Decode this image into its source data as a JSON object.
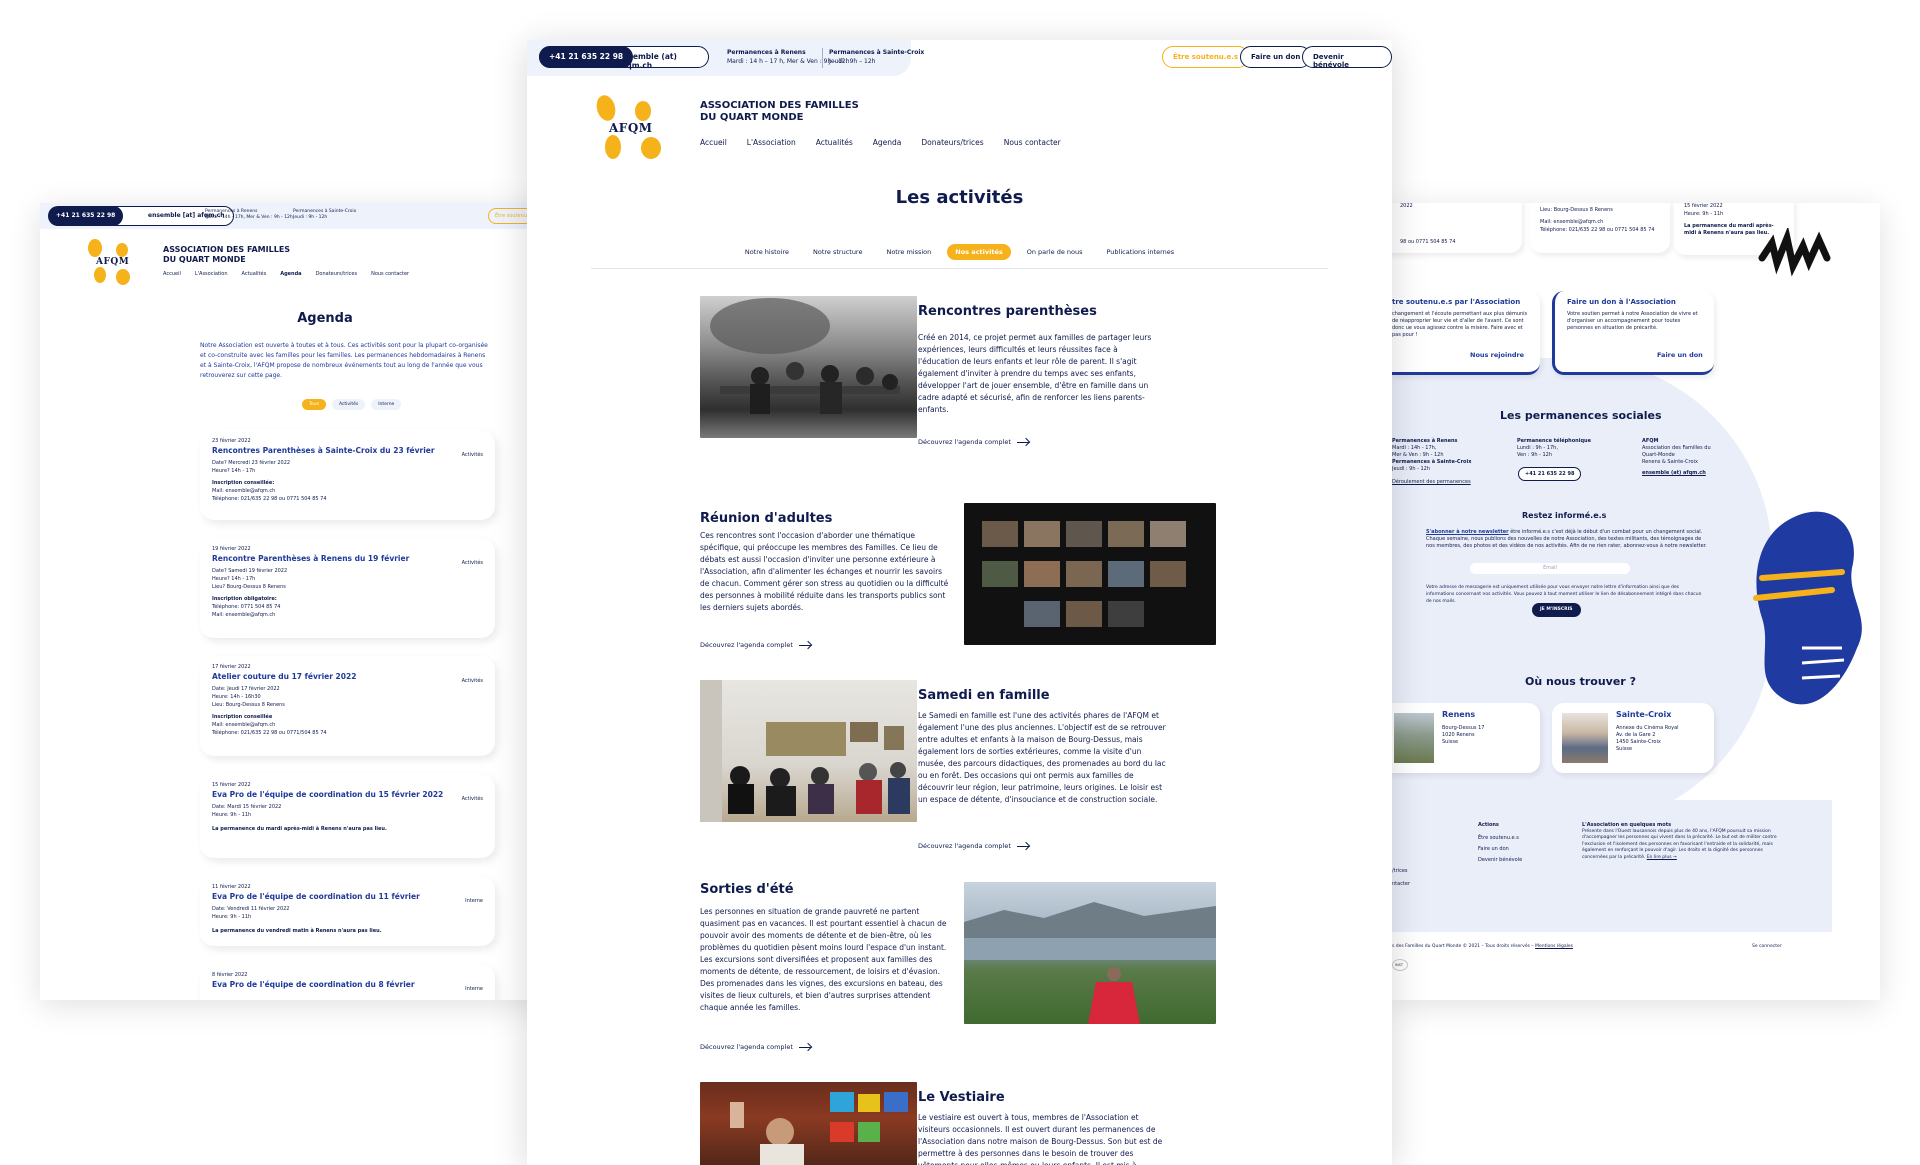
{
  "left": {
    "phone": "+41 21 635 22 98",
    "mail": "ensemble [at] afqm.ch",
    "perm_renens_title": "Permanences à Renens",
    "perm_renens_hours": "Mardi : 14h - 17h, Mer & Ven : 9h - 12h",
    "perm_sc_title": "Permanences à Sainte-Croix",
    "perm_sc_hours": "Jeudi : 9h - 12h",
    "soutenu_button": "Être soutenu.e.s",
    "logo_text": "AFQM",
    "assoc_line1": "ASSOCIATION DES FAMILLES",
    "assoc_line2": "DU QUART MONDE",
    "nav": [
      "Accueil",
      "L'Association",
      "Actualités",
      "Agenda",
      "Donateurs/trices",
      "Nous contacter"
    ],
    "title": "Agenda",
    "intro": "Notre Association est ouverte à toutes et à tous. Ces activités sont pour la plupart co-organisée et co-construite avec les familles pour les familles. Les permanences hebdomadaires à Renens et à Sainte-Croix, l'AFQM propose de nombreux événements tout au long de l'année que vous retrouverez sur cette page.",
    "filters": [
      "Tous",
      "Activités",
      "Interne"
    ],
    "cards": [
      {
        "date": "23 février 2022",
        "title": "Rencontres Parenthèses à Sainte-Croix du 23 février",
        "tag": "Activités",
        "l1": "Date? Mercredi 23 février 2022",
        "l2": "Heure? 14h - 17h",
        "l3": "Inscription conseillée:",
        "l4": "Mail: ensemble@afqm.ch",
        "l5": "Téléphone: 021/635 22 98 ou 0771 504 85 74"
      },
      {
        "date": "19 février 2022",
        "title": "Rencontre Parenthèses à Renens du 19 février",
        "tag": "Activités",
        "l1": "Date? Samedi 19 février 2022",
        "l2": "Heure? 14h - 17h",
        "l3": "Lieu? Bourg-Dessus 8 Renens",
        "l4": "Inscription obligatoire:",
        "l5": "Téléphone: 0771 504 85 74",
        "l6": "Mail: ensemble@afqm.ch"
      },
      {
        "date": "17 février 2022",
        "title": "Atelier couture du 17 février 2022",
        "tag": "Activités",
        "l1": "Date: Jeudi 17 février 2022",
        "l2": "Heure: 14h - 16h30",
        "l3": "Lieu: Bourg-Dessus 8 Renens",
        "l4": "Inscription conseillée",
        "l5": "Mail: ensemble@afqm.ch",
        "l6": "Téléphone: 021/635 22 98 ou 0771/504 85 74"
      },
      {
        "date": "15 février 2022",
        "title": "Eva Pro de l'équipe de coordination du 15 février 2022",
        "tag": "Activités",
        "l1": "Date: Mardi 15 février 2022",
        "l2": "Heure: 9h - 11h",
        "l3": "La permanence du mardi après-midi à Renens n'aura pas lieu."
      },
      {
        "date": "11 février 2022",
        "title": "Eva Pro de l'équipe de coordination du 11 février",
        "tag": "Interne",
        "l1": "Date: Vendredi 11 février 2022",
        "l2": "Heure: 9h - 11h",
        "l3": "La permanence du vendredi matin à Renens n'aura pas lieu."
      },
      {
        "date": "8 février 2022",
        "title": "Eva Pro de l'équipe de coordination du 8 février",
        "tag": "Interne"
      }
    ]
  },
  "center": {
    "phone": "+41 21 635 22 98",
    "mail": "ensemble (at) afqm.ch",
    "perm_renens_title": "Permanences à Renens",
    "perm_renens_hours": "Mardi : 14 h – 17 h,   Mer & Ven : 9h – 12h",
    "perm_sc_title": "Permanences à Sainte-Croix",
    "perm_sc_hours": "Jeudi : 9h – 12h",
    "btn_soutenu": "Être soutenu.e.s",
    "btn_don": "Faire un don",
    "btn_benevole": "Devenir bénévole",
    "logo_text": "AFQM",
    "assoc_line1": "ASSOCIATION DES FAMILLES",
    "assoc_line2": "DU QUART MONDE",
    "nav": [
      "Accueil",
      "L'Association",
      "Actualités",
      "Agenda",
      "Donateurs/trices",
      "Nous contacter"
    ],
    "title": "Les activités",
    "tabs": [
      "Notre histoire",
      "Notre structure",
      "Notre mission",
      "Nos activités",
      "On parle de nous",
      "Publications internes"
    ],
    "active_tab": "Nos activités",
    "link_label": "Découvrez l'agenda complet",
    "sections": [
      {
        "title": "Rencontres parenthèses",
        "text": "Créé en 2014, ce projet permet aux familles de partager leurs expériences, leurs difficultés et leurs réussites face à l'éducation de leurs enfants et leur rôle de parent. Il s'agit également d'inviter à prendre du temps avec ses enfants, développer l'art de jouer ensemble, d'être en famille dans un cadre adapté et sécurisé, afin de renforcer les liens parents-enfants."
      },
      {
        "title": "Réunion d'adultes",
        "text": "Ces rencontres sont l'occasion d'aborder une thématique spécifique, qui préoccupe les membres des Familles. Ce lieu de débats est aussi l'occasion d'inviter une personne extérieure à l'Association, afin d'alimenter les échanges et nourrir les savoirs de chacun. Comment gérer son stress au quotidien ou la difficulté des personnes à mobilité réduite dans les transports publics sont les derniers sujets abordés."
      },
      {
        "title": "Samedi en famille",
        "text": "Le Samedi en famille est l'une des activités phares de l'AFQM et également l'une des plus anciennes. L'objectif est de se retrouver entre adultes et enfants à la maison de Bourg-Dessus, mais également lors de sorties extérieures, comme la visite d'un musée, des parcours didactiques, des promenades au bord du lac ou en forêt. Des occasions qui ont permis aux familles de découvrir leur région, leur patrimoine, leurs origines. Le loisir est un espace de détente, d'insouciance et de construction sociale."
      },
      {
        "title": "Sorties d'été",
        "text": "Les personnes en situation de grande pauvreté ne partent quasiment pas en vacances. Il est pourtant essentiel à chacun de pouvoir avoir des moments de détente et de bien-être, où les problèmes du quotidien pèsent moins lourd l'espace d'un instant. Les excursions sont diversifiées et proposent aux familles des moments de détente, de ressourcement, de loisirs et d'évasion. Des promenades dans les vignes, des excursions en bateau, des visites de lieux culturels, et bien d'autres surprises attendent chaque année les familles."
      },
      {
        "title": "Le Vestiaire",
        "text": "Le vestiaire est ouvert à tous, membres de l'Association et visiteurs occasionnels. Il est ouvert durant les permanences de l'Association dans notre maison de Bourg-Dessus. Son but est de permettre à des personnes dans le besoin de trouver des vêtements pour elles-mêmes ou leurs enfants. Il est mis à"
      }
    ]
  },
  "right": {
    "top_dates": [
      "2022",
      "15 février 2022"
    ],
    "top_lines": [
      "Lieu: Bourg-Dessus 8 Renens",
      "Mail: ensemble@afqm.ch",
      "Téléphone: 021/635 22 98 ou 0771 504 85 74",
      "Heure: 9h - 11h",
      "La permanence du mardi après-midi à Renens n'aura pas lieu."
    ],
    "top_left_phone": "98 ou 0771 504 85 74",
    "card1_title": "tre soutenu.e.s par l'Association",
    "card1_text": "changement et l'écoute permettant aux plus démunis de réapproprier leur vie et d'aller de l'avant. Ce sont donc ue vous agissez contre la misère. Faire avec et pas pour !",
    "card1_link": "Nous rejoindre",
    "card2_title": "Faire un don à l'Association",
    "card2_text": "Votre soutien permet à notre Association de vivre et d'organiser un accompagnement pour toutes personnes en situation de précarité.",
    "card2_link": "Faire un don",
    "perm_title": "Les permanences sociales",
    "perm_col1_title": "Permanences à Renens",
    "perm_col1_l1": "Mardi : 14h - 17h,",
    "perm_col1_l2": "Mer & Ven : 9h - 12h",
    "perm_col1_l3": "Permanences à Sainte-Croix",
    "perm_col1_l4": "Jeudi : 9h - 12h",
    "perm_col1_link": "Déroulement des permanences",
    "perm_col2_title": "Permanence téléphonique",
    "perm_col2_l1": "Lundi : 9h - 17h,",
    "perm_col2_l2": "Ven : 9h - 12h",
    "perm_phone": "+41 21 635 22 98",
    "perm_col3_title": "AFQM",
    "perm_col3_l1": "Association des Familles du Quart-Monde",
    "perm_col3_l2": "Renens & Sainte-Croix",
    "perm_col3_mail": "ensemble (at) afqm.ch",
    "newsletter_title": "Restez informé.e.s",
    "newsletter_lead": "S'abonner à notre newsletter",
    "newsletter_text": "être informé.e.s c'est déjà le début d'un combat pour un changement social. Chaque semaine, nous publions des nouvelles de notre Association, des textes militants, des témoignages de nos membres, des photos et des vidéos de nos activités. Afin de ne rien rater, abonnez-vous à notre newsletter.",
    "email_placeholder": "Email",
    "newsletter_note": "Votre adresse de messagerie est uniquement utilisée pour vous envoyer notre lettre d'information ainsi que des informations concernant nos activités. Vous pouvez à tout moment utiliser le lien de désabonnement intégré dans chacun de nos mails.",
    "subscribe": "JE M'INSCRIS",
    "where_title": "Où nous trouver ?",
    "renens_title": "Renens",
    "renens_addr": [
      "Bourg-Dessus 17",
      "1020 Renens",
      "Suisse"
    ],
    "sc_title": "Sainte-Croix",
    "sc_addr": [
      "Annexe du Cinéma Royal",
      "Av. de la Gare 2",
      "1450 Sainte-Croix",
      "Suisse"
    ],
    "footer_actions_title": "Actions",
    "footer_actions": [
      "Être soutenu.e.s",
      "Faire un don",
      "Devenir bénévole"
    ],
    "footer_left": [
      "/trices",
      "ntacter"
    ],
    "footer_about_title": "L'Association en quelques mots",
    "footer_about": "Présente dans l'Ouest lausannois depuis plus de 40 ans, l'AFQM poursuit sa mission d'accompagner les personnes qui vivent dans la précarité. Le but est de militer contre l'exclusion et l'isolement des personnes en favorisant l'entraide et la solidarité, mais également en renforçant le pouvoir d'agir. Les droits et la dignité des personnes concernées par la précarité.",
    "footer_more": "En lire plus →",
    "copyright": "s des Familles du Quart Monde © 2021 – Tous droits réservés –",
    "legal_link": "Mentions légales",
    "login": "Se connecter",
    "badge": "INST"
  }
}
